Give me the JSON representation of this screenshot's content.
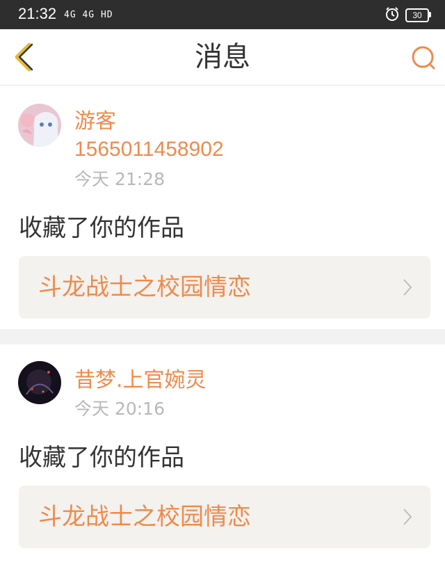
{
  "status_bar": {
    "time": "21:32",
    "network": "4G 4G HD",
    "battery": "30"
  },
  "header": {
    "title": "消息",
    "back_icon": "chevron-left-icon",
    "search_icon": "search-icon"
  },
  "colors": {
    "accent": "#ef8a4c",
    "text_primary": "#333333",
    "text_secondary": "#b8b8b8",
    "card_bg": "#ffffff",
    "work_bg": "#f3f2ee"
  },
  "messages": [
    {
      "username": "游客",
      "user_id": "1565011458902",
      "time": "今天 21:28",
      "action": "收藏了你的作品",
      "work_title": "斗龙战士之校园情恋"
    },
    {
      "username": "昔梦.上官婉灵",
      "time": "今天 20:16",
      "action": "收藏了你的作品",
      "work_title": "斗龙战士之校园情恋"
    }
  ]
}
